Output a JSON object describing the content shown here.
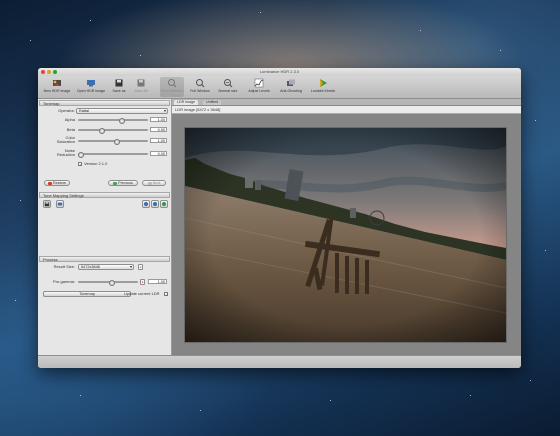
{
  "window": {
    "title": "Luminance HDR 2.3.0"
  },
  "toolbar": {
    "items": [
      {
        "label": "New HDR image",
        "icon": "new-hdr-icon",
        "state": "normal"
      },
      {
        "label": "Open HDR image",
        "icon": "open-hdr-icon",
        "state": "normal"
      },
      {
        "label": "Save as",
        "icon": "save-icon",
        "state": "normal"
      },
      {
        "label": "Save All",
        "icon": "save-all-icon",
        "state": "disabled"
      },
      {
        "label": "Fit to Window",
        "icon": "fit-window-icon",
        "state": "disabled"
      },
      {
        "label": "Full Window",
        "icon": "full-window-icon",
        "state": "normal"
      },
      {
        "label": "Normal size",
        "icon": "normal-size-icon",
        "state": "normal"
      },
      {
        "label": "Adjust Levels",
        "icon": "adjust-levels-icon",
        "state": "normal"
      },
      {
        "label": "Anti-Ghosting",
        "icon": "anti-ghosting-icon",
        "state": "normal"
      },
      {
        "label": "Lumidnt Kinetic",
        "icon": "lumidnt-icon",
        "state": "normal"
      }
    ]
  },
  "tonemap": {
    "header": "Tonemap",
    "operator_label": "Operator:",
    "operator_value": "Rattal",
    "params": [
      {
        "label": "Alpha",
        "value": "1.00",
        "level": 0.62
      },
      {
        "label": "Beta",
        "value": "0.90",
        "level": 0.32
      },
      {
        "label": "Color\nSaturation",
        "value": "1.00",
        "level": 0.55
      },
      {
        "label": "Noise\nReduction",
        "value": "0.00",
        "level": 0.0
      }
    ],
    "version_label": "Version 2.1.0",
    "version_checked": true,
    "buttons": {
      "restore": "Restore",
      "previous": "Previous",
      "next": "Next"
    }
  },
  "tmo_settings": {
    "header": "Tone Mapping Settings"
  },
  "process": {
    "header": "Process",
    "result_size_label": "Result Size:",
    "result_size_value": "5472x3648",
    "pregamma_label": "Pre-gamma:",
    "pregamma_value": "1.00",
    "pregamma_level": 0.55,
    "tonemap_button": "Tonemap",
    "update_label": "Update current LDR",
    "update_checked": true
  },
  "tabs": [
    {
      "label": "LDR image",
      "active": true
    },
    {
      "label": "Untitled",
      "active": false
    }
  ],
  "image_info": "LDR image [5472 x 3648]",
  "colors": {
    "accent": "#1b4fa0",
    "panel": "#e6e6e6",
    "viewer": "#858585"
  }
}
